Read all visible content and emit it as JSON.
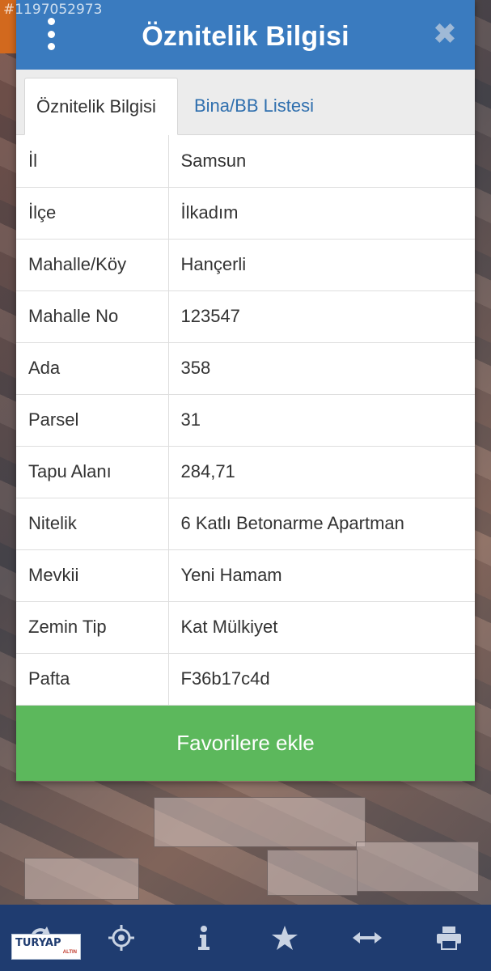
{
  "watermark": "#1197052973",
  "dialog": {
    "title": "Öznitelik Bilgisi",
    "tabs": [
      {
        "label": "Öznitelik Bilgisi",
        "active": true
      },
      {
        "label": "Bina/BB Listesi",
        "active": false
      }
    ],
    "rows": [
      {
        "key": "İl",
        "value": "Samsun"
      },
      {
        "key": "İlçe",
        "value": "İlkadım"
      },
      {
        "key": "Mahalle/Köy",
        "value": "Hançerli"
      },
      {
        "key": "Mahalle No",
        "value": "123547"
      },
      {
        "key": "Ada",
        "value": "358"
      },
      {
        "key": "Parsel",
        "value": "31"
      },
      {
        "key": "Tapu Alanı",
        "value": "284,71"
      },
      {
        "key": "Nitelik",
        "value": "6 Katlı Betonarme Apartman"
      },
      {
        "key": "Mevkii",
        "value": "Yeni Hamam"
      },
      {
        "key": "Zemin Tip",
        "value": "Kat Mülkiyet"
      },
      {
        "key": "Pafta",
        "value": "F36b17c4d"
      }
    ],
    "favorite_button": "Favorilere ekle"
  },
  "logo": {
    "main": "TURYAP",
    "sub": "ALTIN"
  },
  "toolbar": {
    "icons": [
      "refresh-icon",
      "locate-icon",
      "info-icon",
      "star-icon",
      "measure-icon",
      "print-icon"
    ]
  },
  "colors": {
    "header": "#3a7bbf",
    "tab_link": "#2f6fae",
    "favorite": "#5cb85c",
    "toolbar": "#1f3c70"
  }
}
